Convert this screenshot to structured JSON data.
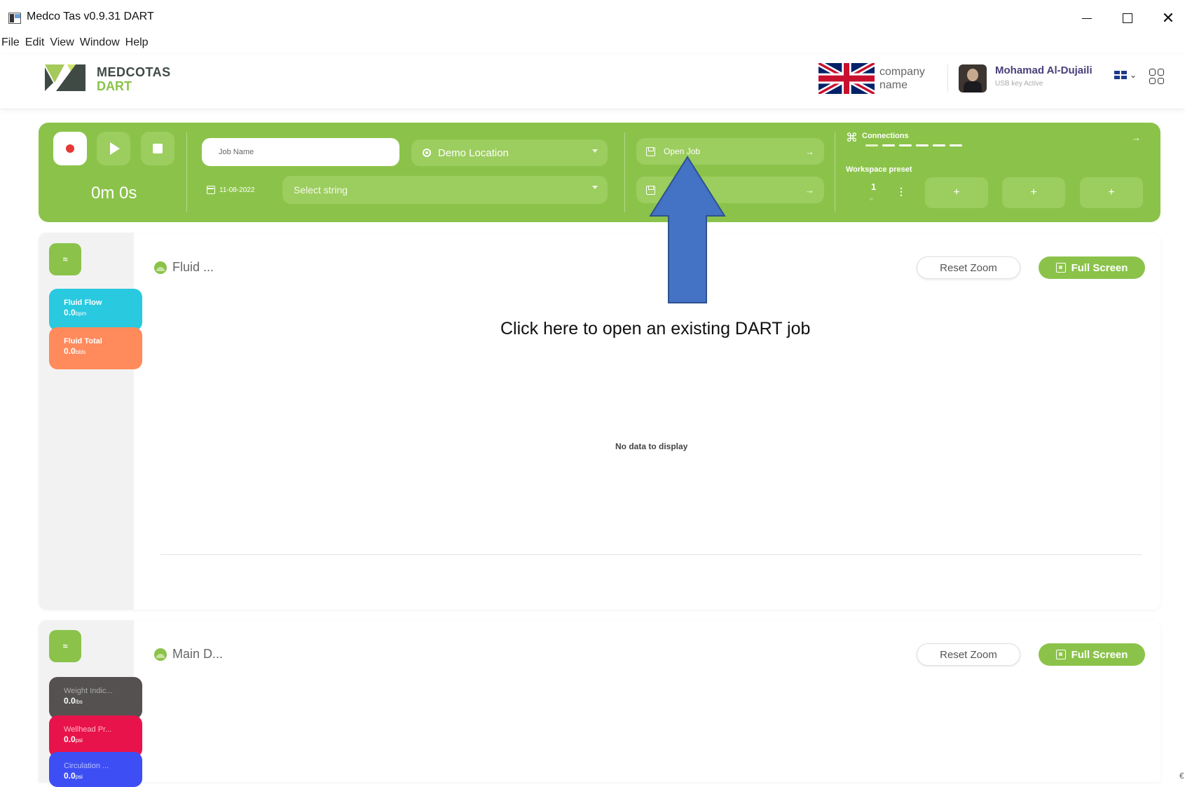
{
  "window": {
    "title": "Medco Tas v0.9.31  DART",
    "min_icon": "minimize-icon",
    "max_icon": "maximize-icon",
    "close_glyph": "✕"
  },
  "menu": [
    "File",
    "Edit",
    "View",
    "Window",
    "Help"
  ],
  "header": {
    "logo_title": "MEDCOTAS",
    "logo_sub": "DART",
    "company": "company name",
    "user_name": "Mohamad Al-Dujaili",
    "user_status": "USB key Active",
    "lang_chevron": "⌄"
  },
  "toolbar": {
    "timer": "0m 0s",
    "job_name_placeholder": "Job Name",
    "location": "Demo Location",
    "date": "11-08-2022",
    "string_placeholder": "Select string",
    "open_job": "Open Job",
    "save_job": "",
    "arrow": "→",
    "connections_icon": "⌘",
    "connections_label": "Connections",
    "workspace_label": "Workspace preset",
    "presets": [
      {
        "number": "1",
        "sub": "≈",
        "menu": "⋮"
      },
      {
        "label": "+"
      },
      {
        "label": "+"
      },
      {
        "label": "+"
      }
    ],
    "accent_color": "#8bc34a"
  },
  "panels": [
    {
      "settings_icon": "≈",
      "title": "Fluid ...",
      "reset_zoom": "Reset Zoom",
      "full_screen": "Full Screen",
      "empty_text": "No data to display",
      "sensors": [
        {
          "name": "Fluid Flow",
          "value": "0.0",
          "unit": "bpm",
          "color": "#29c9e0"
        },
        {
          "name": "Fluid Total",
          "value": "0.0",
          "unit": "bbls",
          "color": "#ff8a5c"
        }
      ]
    },
    {
      "settings_icon": "≈",
      "title": "Main D...",
      "reset_zoom": "Reset Zoom",
      "full_screen": "Full Screen",
      "sensors": [
        {
          "name": "Weight Indic...",
          "value": "0.0",
          "unit": "lbs",
          "color": "#555151"
        },
        {
          "name": "Wellhead Pr...",
          "value": "0.0",
          "unit": "psi",
          "color": "#e8134a"
        },
        {
          "name": "Circulation ...",
          "value": "0.0",
          "unit": "psi",
          "color": "#3d4ef5"
        }
      ]
    }
  ],
  "annotation": {
    "text": "Click here to open an existing DART job",
    "arrow_color": "#4472c4"
  },
  "edge_mark": "€"
}
